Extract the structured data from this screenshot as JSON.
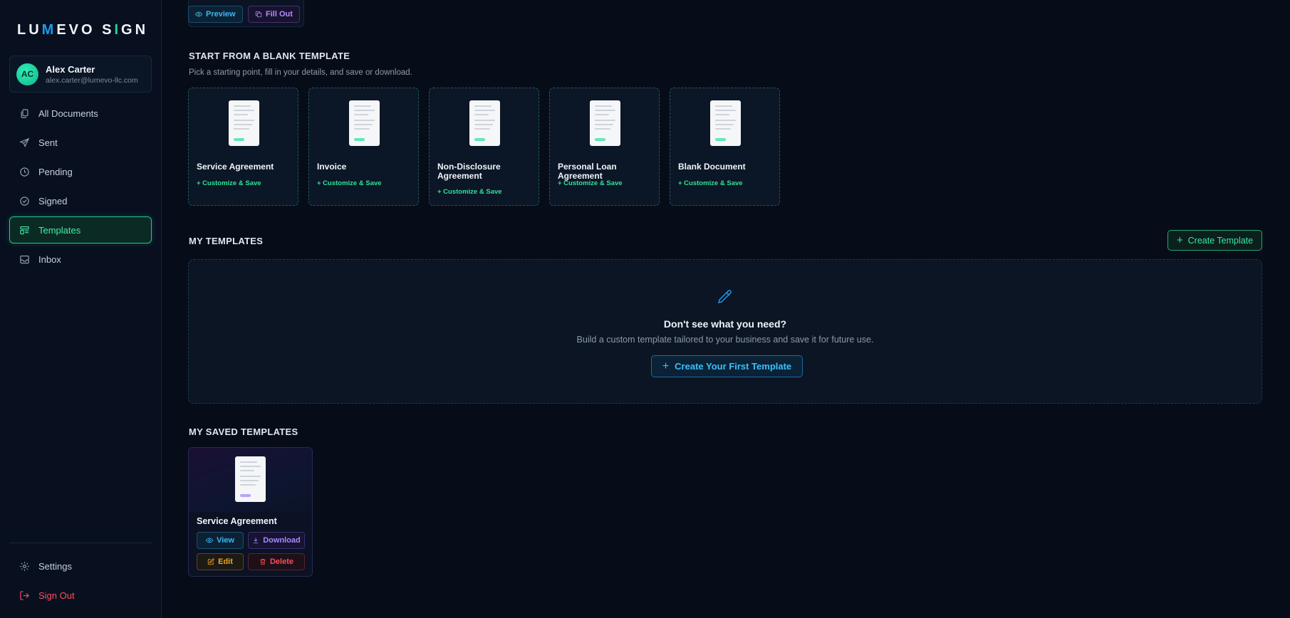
{
  "brand": {
    "logo_parts": [
      "LU",
      "M",
      "EVO S",
      "I",
      "GN"
    ]
  },
  "user": {
    "initials": "AC",
    "name": "Alex Carter",
    "email": "alex.carter@lumevo-llc.com"
  },
  "sidebar": {
    "items": [
      {
        "label": "All Documents",
        "icon": "documents-icon"
      },
      {
        "label": "Sent",
        "icon": "send-icon"
      },
      {
        "label": "Pending",
        "icon": "clock-icon"
      },
      {
        "label": "Signed",
        "icon": "check-circle-icon"
      },
      {
        "label": "Templates",
        "icon": "templates-icon",
        "active": true
      },
      {
        "label": "Inbox",
        "icon": "inbox-icon"
      }
    ],
    "bottom": [
      {
        "label": "Settings",
        "icon": "gear-icon"
      },
      {
        "label": "Sign Out",
        "icon": "sign-out-icon"
      }
    ]
  },
  "top_card": {
    "preview_label": "Preview",
    "fill_out_label": "Fill Out"
  },
  "blank_section": {
    "title": "START FROM A BLANK TEMPLATE",
    "subtitle": "Pick a starting point, fill in your details, and save or download.",
    "templates": [
      {
        "name": "Service Agreement",
        "action": "+ Customize & Save"
      },
      {
        "name": "Invoice",
        "action": "+ Customize & Save"
      },
      {
        "name": "Non-Disclosure Agreement",
        "action": "+ Customize & Save"
      },
      {
        "name": "Personal Loan Agreement",
        "action": "+ Customize & Save"
      },
      {
        "name": "Blank Document",
        "action": "+ Customize & Save"
      }
    ]
  },
  "my_templates": {
    "title": "MY TEMPLATES",
    "create_label": "Create Template",
    "empty_title": "Don't see what you need?",
    "empty_subtitle": "Build a custom template tailored to your business and save it for future use.",
    "empty_button": "Create Your First Template"
  },
  "saved_templates": {
    "title": "MY SAVED TEMPLATES",
    "items": [
      {
        "name": "Service Agreement",
        "view": "View",
        "download": "Download",
        "edit": "Edit",
        "delete": "Delete"
      }
    ]
  },
  "colors": {
    "accent_green": "#2fe39b",
    "accent_blue": "#3cb7f2",
    "accent_purple": "#a58bff",
    "accent_orange": "#f3a722",
    "accent_red": "#ff4d5a",
    "background": "#070d18"
  }
}
